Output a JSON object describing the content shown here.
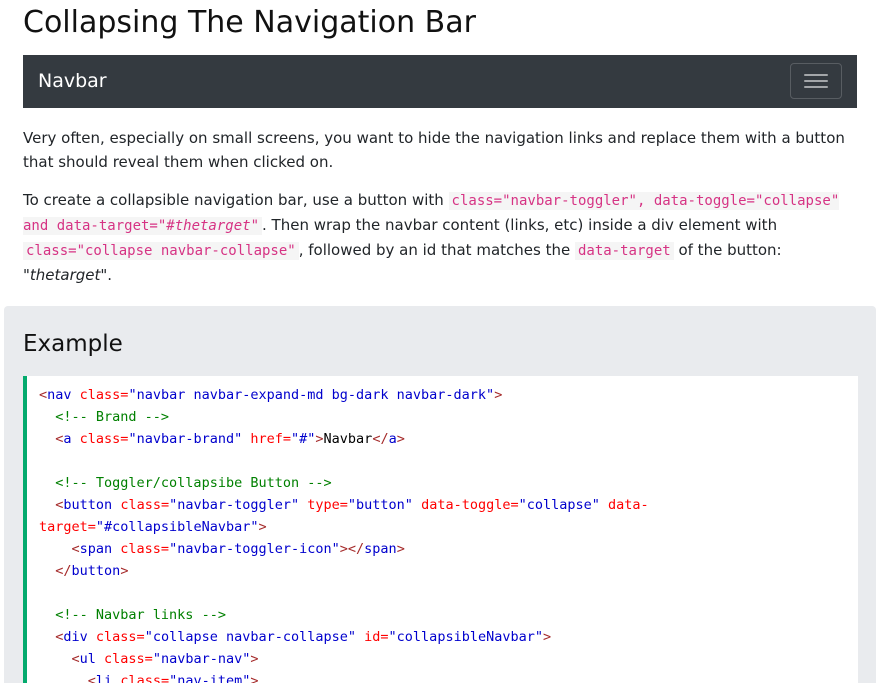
{
  "page": {
    "title": "Collapsing The Navigation Bar"
  },
  "demo_navbar": {
    "brand": "Navbar",
    "toggler_icon": "hamburger-menu-icon",
    "background": "#343a40"
  },
  "paragraph1": "Very often, especially on small screens, you want to hide the navigation links and replace them with a button that should reveal them when clicked on.",
  "paragraph2": {
    "t1": "To create a collapsible navigation bar, use a button with ",
    "c1": "class=\"navbar-toggler\", data-toggle=\"collapse\" and data-target=\"#",
    "c1_em": "thetarget",
    "c1_end": "\"",
    "t2": ". Then wrap the navbar content (links, etc) inside a div element with ",
    "c2": "class=\"collapse navbar-collapse\"",
    "t3": ", followed by an id that matches the ",
    "c3": "data-target",
    "t4": " of the button: \"",
    "t4_em": "thetarget",
    "t5": "\"."
  },
  "example": {
    "title": "Example",
    "accent": "#04aa6d",
    "lines": [
      {
        "tokens": [
          [
            "tag",
            "<"
          ],
          [
            "tagname",
            "nav "
          ],
          [
            "attr",
            "class="
          ],
          [
            "val",
            "\"navbar navbar-expand-md bg-dark navbar-dark\""
          ],
          [
            "tag",
            ">"
          ]
        ]
      },
      {
        "tokens": [
          [
            "plain",
            "  "
          ],
          [
            "cmt",
            "<!-- Brand -->"
          ]
        ]
      },
      {
        "tokens": [
          [
            "plain",
            "  "
          ],
          [
            "tag",
            "<"
          ],
          [
            "tagname",
            "a "
          ],
          [
            "attr",
            "class="
          ],
          [
            "val",
            "\"navbar-brand\" "
          ],
          [
            "attr",
            "href="
          ],
          [
            "val",
            "\"#\""
          ],
          [
            "tag",
            ">"
          ],
          [
            "plain",
            "Navbar"
          ],
          [
            "tag",
            "</"
          ],
          [
            "tagname",
            "a"
          ],
          [
            "tag",
            ">"
          ]
        ]
      },
      {
        "tokens": []
      },
      {
        "tokens": [
          [
            "plain",
            "  "
          ],
          [
            "cmt",
            "<!-- Toggler/collapsibe Button -->"
          ]
        ]
      },
      {
        "tokens": [
          [
            "plain",
            "  "
          ],
          [
            "tag",
            "<"
          ],
          [
            "tagname",
            "button "
          ],
          [
            "attr",
            "class="
          ],
          [
            "val",
            "\"navbar-toggler\" "
          ],
          [
            "attr",
            "type="
          ],
          [
            "val",
            "\"button\" "
          ],
          [
            "attr",
            "data-toggle="
          ],
          [
            "val",
            "\"collapse\" "
          ],
          [
            "attr",
            "data-"
          ]
        ]
      },
      {
        "tokens": [
          [
            "attr",
            "target="
          ],
          [
            "val",
            "\"#collapsibleNavbar\""
          ],
          [
            "tag",
            ">"
          ]
        ]
      },
      {
        "tokens": [
          [
            "plain",
            "    "
          ],
          [
            "tag",
            "<"
          ],
          [
            "tagname",
            "span "
          ],
          [
            "attr",
            "class="
          ],
          [
            "val",
            "\"navbar-toggler-icon\""
          ],
          [
            "tag",
            ">"
          ],
          [
            "tag",
            "</"
          ],
          [
            "tagname",
            "span"
          ],
          [
            "tag",
            ">"
          ]
        ]
      },
      {
        "tokens": [
          [
            "plain",
            "  "
          ],
          [
            "tag",
            "</"
          ],
          [
            "tagname",
            "button"
          ],
          [
            "tag",
            ">"
          ]
        ]
      },
      {
        "tokens": []
      },
      {
        "tokens": [
          [
            "plain",
            "  "
          ],
          [
            "cmt",
            "<!-- Navbar links -->"
          ]
        ]
      },
      {
        "tokens": [
          [
            "plain",
            "  "
          ],
          [
            "tag",
            "<"
          ],
          [
            "tagname",
            "div "
          ],
          [
            "attr",
            "class="
          ],
          [
            "val",
            "\"collapse navbar-collapse\" "
          ],
          [
            "attr",
            "id="
          ],
          [
            "val",
            "\"collapsibleNavbar\""
          ],
          [
            "tag",
            ">"
          ]
        ]
      },
      {
        "tokens": [
          [
            "plain",
            "    "
          ],
          [
            "tag",
            "<"
          ],
          [
            "tagname",
            "ul "
          ],
          [
            "attr",
            "class="
          ],
          [
            "val",
            "\"navbar-nav\""
          ],
          [
            "tag",
            ">"
          ]
        ]
      },
      {
        "tokens": [
          [
            "plain",
            "      "
          ],
          [
            "tag",
            "<"
          ],
          [
            "tagname",
            "li "
          ],
          [
            "attr",
            "class="
          ],
          [
            "val",
            "\"nav-item\""
          ],
          [
            "tag",
            ">"
          ]
        ]
      }
    ]
  }
}
